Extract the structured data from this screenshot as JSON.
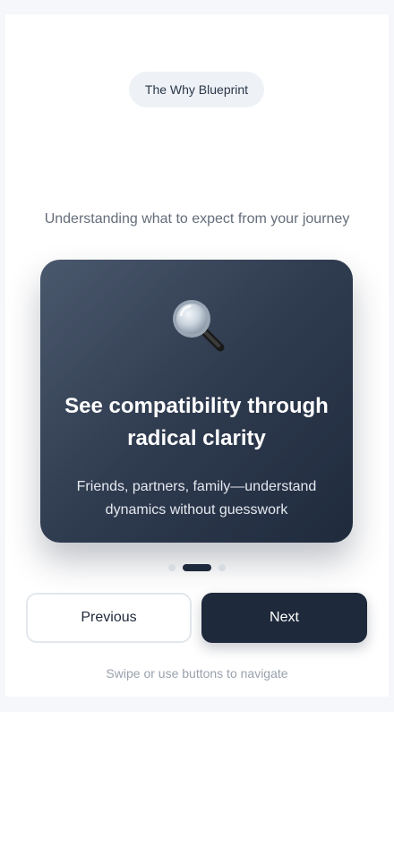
{
  "header": {
    "badge_label": "The Why Blueprint",
    "subtitle": "Understanding what to expect from your journey"
  },
  "slide": {
    "icon": "magnifying-glass-icon",
    "title": "See compatibility through radical clarity",
    "description": "Friends, partners, family—understand dynamics without guesswork"
  },
  "pagination": {
    "total": 3,
    "active_index": 1
  },
  "nav": {
    "previous_label": "Previous",
    "next_label": "Next",
    "hint": "Swipe or use buttons to navigate"
  },
  "colors": {
    "primary": "#1e293b",
    "card_gradient_start": "#4a586d",
    "card_gradient_end": "#1f2a3d",
    "background": "#f5f7fa"
  }
}
